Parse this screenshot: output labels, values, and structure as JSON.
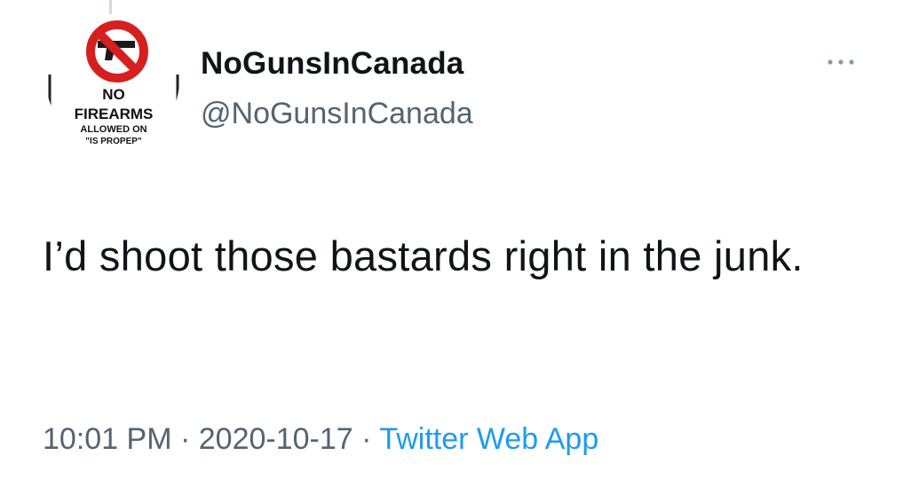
{
  "tweet": {
    "avatar": {
      "icon": "no-firearms-sign-icon",
      "sign_lines": [
        "NO",
        "FIREARMS",
        "ALLOWED ON",
        "\"IS PROPEP\""
      ],
      "sign_color": "#d6201f"
    },
    "display_name": "NoGunsInCanada",
    "handle": "@NoGunsInCanada",
    "more_icon": "more-horizontal-icon",
    "text": "I’d shoot those bastards right in the junk.",
    "time": "10:01 PM",
    "separator": "·",
    "date": "2020-10-17",
    "source": "Twitter Web App",
    "colors": {
      "primary_text": "#0f1419",
      "secondary_text": "#536471",
      "link": "#1d9bf0"
    }
  }
}
